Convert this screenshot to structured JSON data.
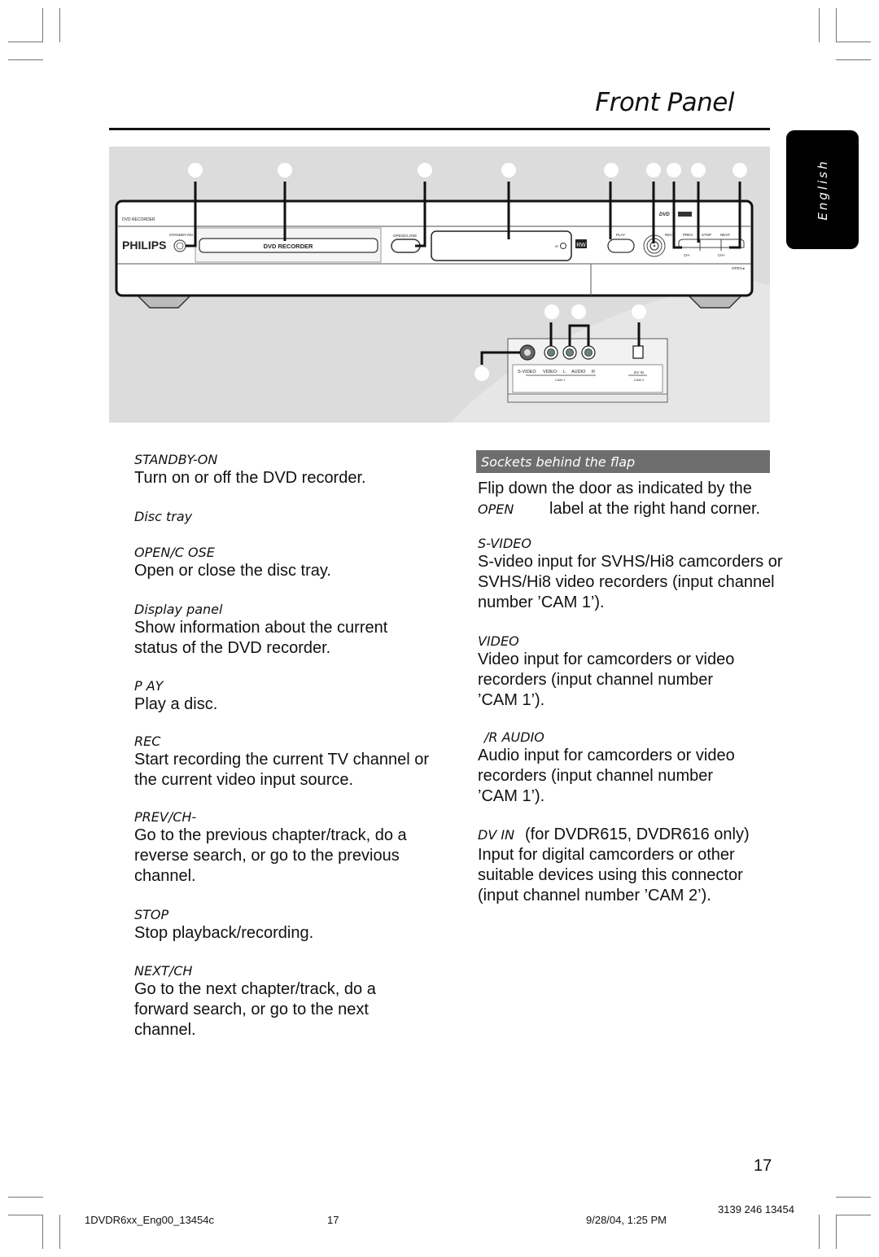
{
  "page": {
    "title": "Front Panel",
    "language_tab": "English",
    "page_number": "17"
  },
  "figure": {
    "device_brand": "PHILIPS",
    "device_model_label": "DVD RECORDER",
    "panel_label_top": "DVD RECORDER",
    "controls": {
      "standby_on": "STANDBY-ON",
      "open_close": "OPEN/CLOSE",
      "play": "PLAY",
      "rec": "REC",
      "prev": "PREV.",
      "stop": "STOP",
      "next": "NEXT",
      "ch_minus": "CH-",
      "ch_plus": "CH+",
      "open_flap": "OPEN ▸",
      "ir": "IR",
      "rw_logo": "RW",
      "dvd_logo": "DVD"
    },
    "sockets": {
      "s_video": "S-VIDEO",
      "video": "VIDEO",
      "audio_l": "L",
      "audio": "AUDIO",
      "audio_r": "R",
      "cam1": "CAM 1",
      "dv_in": "DV IN",
      "cam2": "CAM 2"
    }
  },
  "left_column": [
    {
      "term": "STANDBY-ON",
      "desc": "Turn on or off the DVD recorder."
    },
    {
      "term": "Disc tray",
      "desc": ""
    },
    {
      "term": "OPEN/C  OSE",
      "desc": "Open or close the disc tray."
    },
    {
      "term": "Display panel",
      "desc": "Show information about the current status of the DVD recorder."
    },
    {
      "term": "P  AY",
      "desc": "Play a disc."
    },
    {
      "term": "REC",
      "desc": "Start recording the current TV channel or the current video input source."
    },
    {
      "term": "PREV/CH-",
      "desc": "Go to the previous chapter/track, do a reverse search, or go to the previous channel."
    },
    {
      "term": "STOP",
      "desc": "Stop playback/recording."
    },
    {
      "term": "NEXT/CH",
      "desc": "Go to the next chapter/track, do a forward search, or go to the next channel."
    }
  ],
  "right_column": {
    "header": "Sockets behind the flap",
    "intro_line1": "Flip down the door as indicated by the",
    "intro_term": "OPEN",
    "intro_line2": "label at the right hand corner.",
    "items": [
      {
        "term": "S-VIDEO",
        "desc": "S-video input for SVHS/Hi8 camcorders or SVHS/Hi8 video recorders (input channel number ’CAM 1’)."
      },
      {
        "term": "VIDEO",
        "desc": "Video input for camcorders or video recorders (input channel number ’CAM 1’)."
      },
      {
        "term": "/R AUDIO",
        "desc": "Audio input for camcorders or video recorders (input channel number ’CAM 1’)."
      },
      {
        "term": "DV IN",
        "term_suffix": "(for DVDR615, DVDR616 only)",
        "desc": "Input for digital camcorders or other suitable devices using this connector (input channel number ’CAM 2’)."
      }
    ]
  },
  "footer": {
    "file_name": "1DVDR6xx_Eng00_13454c",
    "page": "17",
    "timestamp": "9/28/04, 1:25 PM",
    "code": "3139 246 13454"
  }
}
